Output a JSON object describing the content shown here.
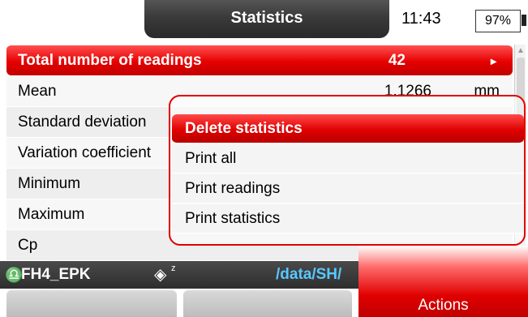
{
  "header": {
    "title": "Statistics",
    "time": "11:43",
    "battery": "97%"
  },
  "stats": [
    {
      "label": "Total number of readings",
      "value": "42",
      "unit": "",
      "selected": true
    },
    {
      "label": "Mean",
      "value": "1.1266",
      "unit": "mm"
    },
    {
      "label": "Standard deviation",
      "value": "",
      "unit": ""
    },
    {
      "label": "Variation coefficient",
      "value": "",
      "unit": ""
    },
    {
      "label": "Minimum",
      "value": "",
      "unit": ""
    },
    {
      "label": "Maximum",
      "value": "",
      "unit": ""
    },
    {
      "label": "Cp",
      "value": "",
      "unit": ""
    }
  ],
  "infobar": {
    "probe_name": "FH4_EPK",
    "path": "/data/SH/"
  },
  "actions_menu": {
    "items": [
      "Delete statistics",
      "Print all",
      "Print readings",
      "Print statistics"
    ],
    "selected_index": 0
  },
  "softkeys": {
    "key1": "",
    "key2": "",
    "key3": "Actions"
  },
  "icons": {
    "probe": "probe-icon",
    "target": "target-z-icon",
    "arrow": "chevron-right-icon"
  },
  "colors": {
    "accent_red": "#e00000",
    "path_blue": "#57c8ff",
    "bar_dark": "#333333"
  }
}
